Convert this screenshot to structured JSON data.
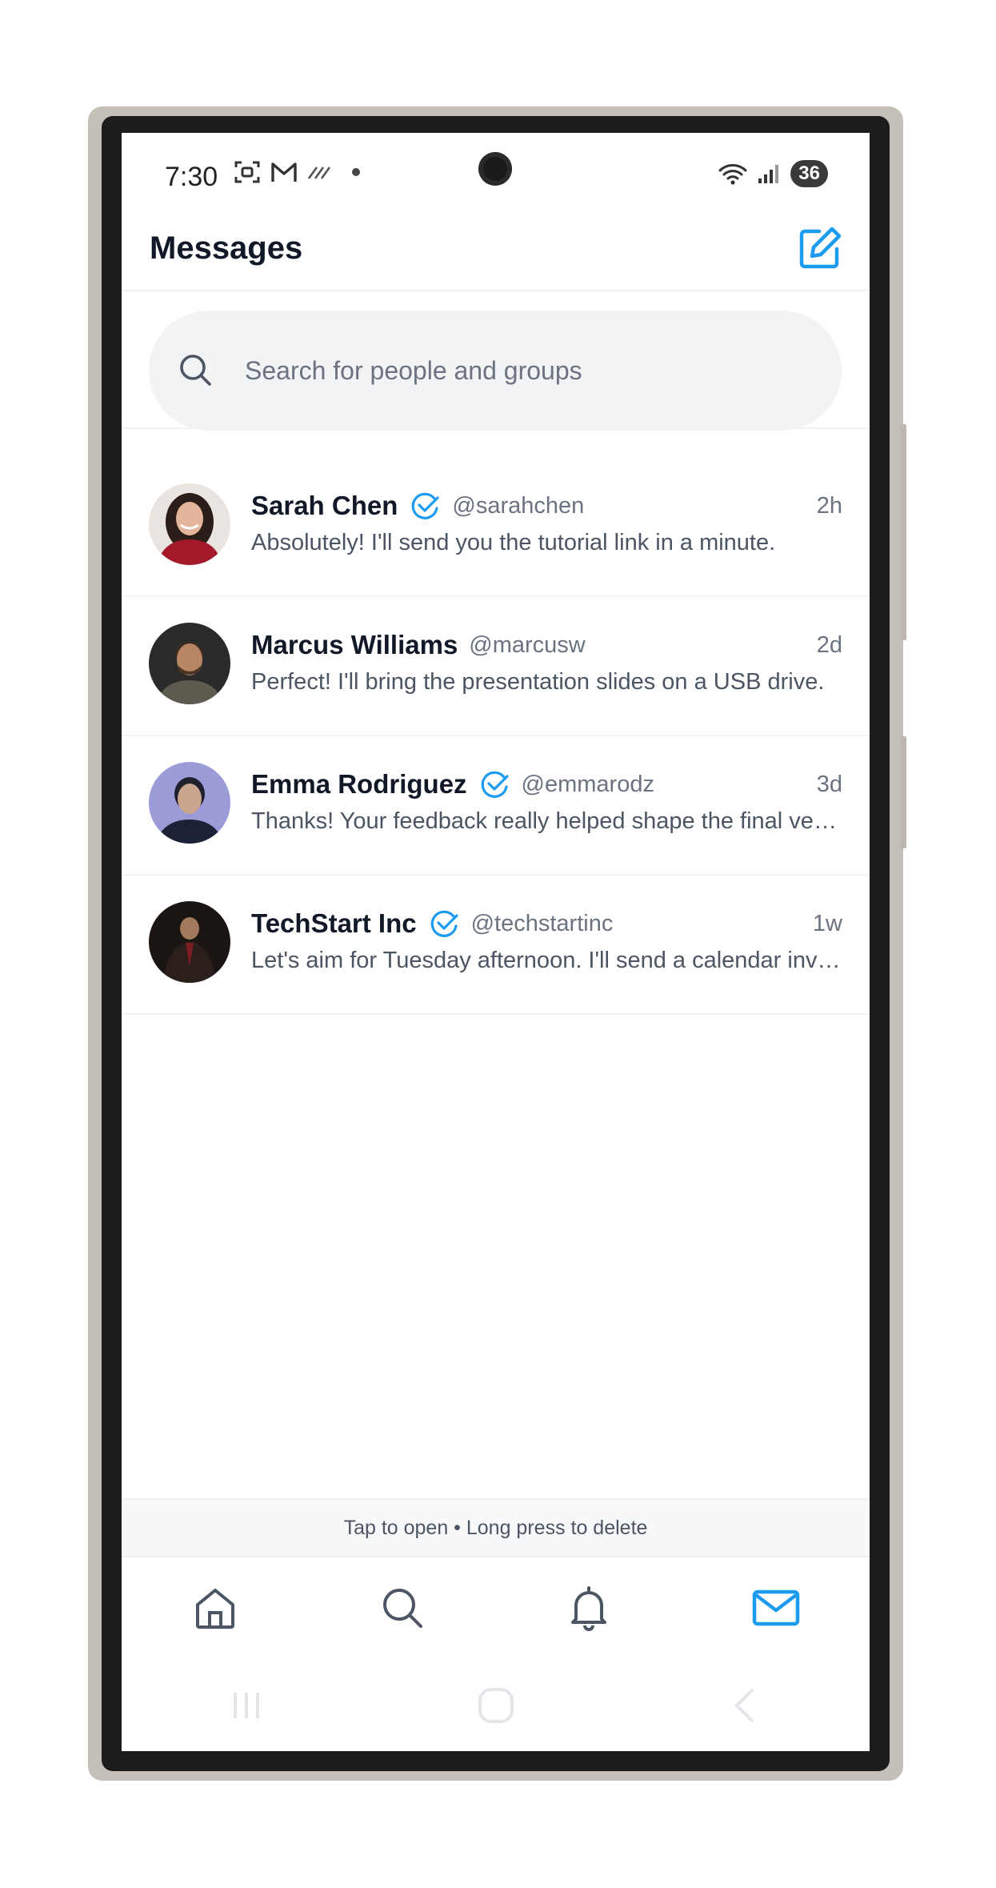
{
  "status_bar": {
    "time": "7:30",
    "battery": "36"
  },
  "header": {
    "title": "Messages"
  },
  "search": {
    "placeholder": "Search for people and groups"
  },
  "conversations": [
    {
      "name": "Sarah Chen",
      "verified": true,
      "handle": "@sarahchen",
      "time": "2h",
      "preview": "Absolutely! I'll send you the tutorial link in a minute."
    },
    {
      "name": "Marcus Williams",
      "verified": false,
      "handle": "@marcusw",
      "time": "2d",
      "preview": "Perfect! I'll bring the presentation slides on a USB drive."
    },
    {
      "name": "Emma Rodriguez",
      "verified": true,
      "handle": "@emmarodz",
      "time": "3d",
      "preview": "Thanks! Your feedback really helped shape the final version."
    },
    {
      "name": "TechStart Inc",
      "verified": true,
      "handle": "@techstartinc",
      "time": "1w",
      "preview": "Let's aim for Tuesday afternoon. I'll send a calendar invite."
    }
  ],
  "hint": "Tap to open • Long press to delete",
  "nav": [
    {
      "icon": "home-icon"
    },
    {
      "icon": "search-icon"
    },
    {
      "icon": "bell-icon"
    },
    {
      "icon": "mail-icon",
      "active": true
    }
  ],
  "colors": {
    "accent": "#1d9bf0",
    "muted": "#6b7280",
    "title": "#111827"
  }
}
